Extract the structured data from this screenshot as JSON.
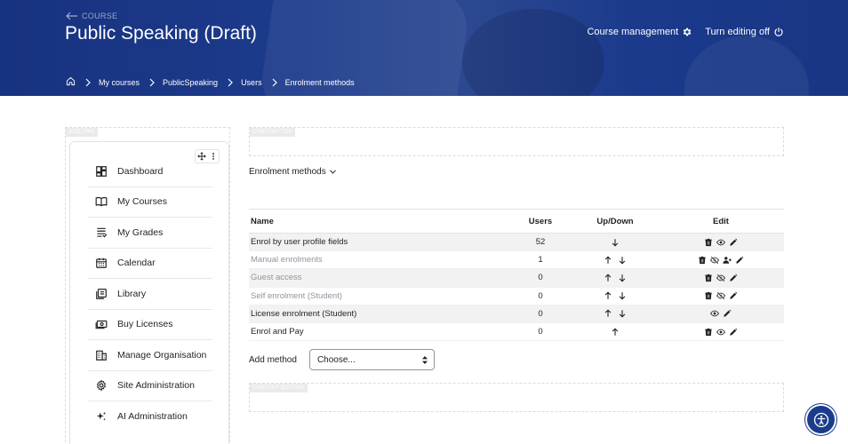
{
  "header": {
    "back_label": "COURSE",
    "title": "Public Speaking (Draft)",
    "course_management_label": "Course management",
    "turn_editing_label": "Turn editing off"
  },
  "breadcrumb": [
    "My courses",
    "PublicSpeaking",
    "Users",
    "Enrolment methods"
  ],
  "regions": {
    "side_pre": "SIDE-PRE",
    "content_top": "CONTENT-TOP",
    "content_bottom": "CONTENT BOTTOM"
  },
  "sidebar": {
    "items": [
      {
        "label": "Dashboard",
        "icon": "dashboard-icon"
      },
      {
        "label": "My Courses",
        "icon": "book-open-icon"
      },
      {
        "label": "My Grades",
        "icon": "grades-list-icon"
      },
      {
        "label": "Calendar",
        "icon": "calendar-icon"
      },
      {
        "label": "Library",
        "icon": "library-icon"
      },
      {
        "label": "Buy Licenses",
        "icon": "money-icon"
      },
      {
        "label": "Manage Organisation",
        "icon": "building-icon"
      },
      {
        "label": "Site Administration",
        "icon": "gear-icon"
      },
      {
        "label": "AI Administration",
        "icon": "sparkle-icon"
      }
    ]
  },
  "main": {
    "section_dropdown": "Enrolment methods",
    "table": {
      "headers": {
        "name": "Name",
        "users": "Users",
        "updown": "Up/Down",
        "edit": "Edit"
      },
      "rows": [
        {
          "name": "Enrol by user profile fields",
          "users": "52",
          "enabled": true,
          "arrows": [
            "down"
          ],
          "edit_icons": [
            "delete",
            "eye",
            "edit"
          ]
        },
        {
          "name": "Manual enrolments",
          "users": "1",
          "enabled": false,
          "arrows": [
            "up",
            "down"
          ],
          "edit_icons": [
            "delete",
            "eye-off",
            "enrol-users",
            "edit"
          ]
        },
        {
          "name": "Guest access",
          "users": "0",
          "enabled": false,
          "arrows": [
            "up",
            "down"
          ],
          "edit_icons": [
            "delete",
            "eye-off",
            "edit"
          ]
        },
        {
          "name": "Self enrolment (Student)",
          "users": "0",
          "enabled": false,
          "arrows": [
            "up",
            "down"
          ],
          "edit_icons": [
            "delete",
            "eye-off",
            "edit"
          ]
        },
        {
          "name": "License enrolment (Student)",
          "users": "0",
          "enabled": true,
          "arrows": [
            "up",
            "down"
          ],
          "edit_icons": [
            "eye",
            "edit"
          ]
        },
        {
          "name": "Enrol and Pay",
          "users": "0",
          "enabled": true,
          "arrows": [
            "up"
          ],
          "edit_icons": [
            "delete",
            "eye",
            "edit"
          ]
        }
      ]
    },
    "add_method_label": "Add method",
    "add_method_select": "Choose..."
  },
  "colors": {
    "header_bg": "#1b3a8c",
    "accent": "#1b3c8c",
    "stripe": "#f2f2f2",
    "disabled_text": "#8f959e"
  }
}
